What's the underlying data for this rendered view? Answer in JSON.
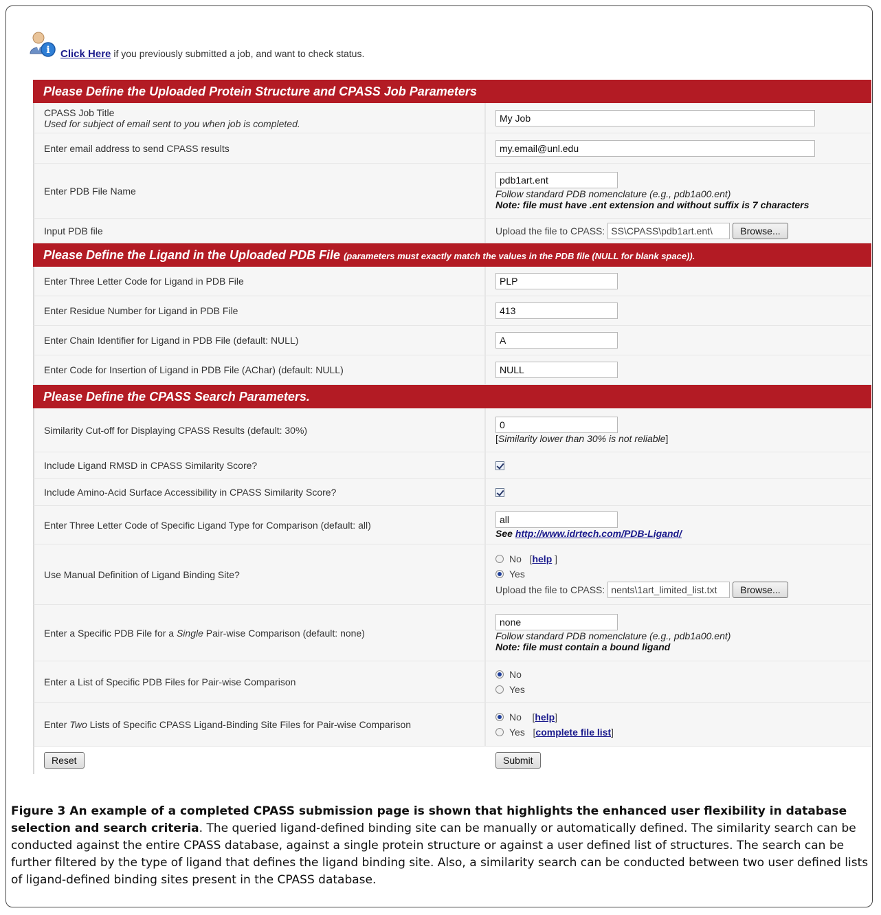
{
  "topbar": {
    "link": "Click Here",
    "text": "if you previously submitted a job, and want to check status."
  },
  "sections": {
    "s1": "Please Define the Uploaded Protein Structure and CPASS Job Parameters",
    "s2": "Please Define the Ligand in the Uploaded PDB File",
    "s2_sub": "(parameters must exactly match the values in the PDB file (NULL for blank space)).",
    "s3": "Please Define the CPASS Search Parameters."
  },
  "job": {
    "title_label": "CPASS Job Title",
    "title_note": "Used for subject of email sent to you when job is completed.",
    "title_value": "My Job",
    "email_label": "Enter email address to send CPASS results",
    "email_value": "my.email@unl.edu",
    "pdbname_label": "Enter PDB File Name",
    "pdbname_value": "pdb1art.ent",
    "pdbname_hint": "Follow standard PDB nomenclature (e.g., pdb1a00.ent)",
    "pdbname_note": "Note: file must have .ent extension and without suffix is 7 characters",
    "input_label": "Input PDB file",
    "upload_label": "Upload the file to CPASS:",
    "upload_value": "\\SS\\CPASS\\pdb1art.ent",
    "browse": "Browse..."
  },
  "ligand": {
    "code_label": "Enter Three Letter Code for Ligand in PDB File",
    "code_value": "PLP",
    "residue_label": "Enter Residue Number for Ligand in PDB File",
    "residue_value": "413",
    "chain_label": "Enter Chain Identifier for Ligand in PDB File (default: NULL)",
    "chain_value": "A",
    "insertion_label": "Enter Code for Insertion of Ligand in PDB File (AChar) (default: NULL)",
    "insertion_value": "NULL"
  },
  "search": {
    "cutoff_label": "Similarity Cut-off for Displaying CPASS Results (default: 30%)",
    "cutoff_value": "0",
    "cutoff_hint_open": "[",
    "cutoff_hint": "Similarity lower than 30% is not reliable",
    "cutoff_hint_close": "]",
    "rmsd_label": "Include Ligand RMSD in CPASS Similarity Score?",
    "rmsd_checked": true,
    "access_label": "Include Amino-Acid Surface Accessibility in CPASS Similarity Score?",
    "access_checked": true,
    "type_label": "Enter Three Letter Code of Specific Ligand Type for Comparison (default: all)",
    "type_value": "all",
    "type_see": "See",
    "type_link": "http://www.idrtech.com/PDB-Ligand/",
    "manual_label": "Use Manual Definition of Ligand Binding Site?",
    "no": "No",
    "yes": "Yes",
    "help": "help",
    "manual_upload_value": "nents\\1art_limited_list.txt",
    "single_label_a": "Enter a Specific PDB File for a",
    "single_label_em": "Single",
    "single_label_b": "Pair-wise Comparison (default: none)",
    "single_value": "none",
    "single_hint": "Follow standard PDB nomenclature (e.g., pdb1a00.ent)",
    "single_note": "Note: file must contain a bound ligand",
    "list_label": "Enter a List of Specific PDB Files for Pair-wise Comparison",
    "two_label_a": "Enter",
    "two_label_em": "Two",
    "two_label_b": "Lists of Specific CPASS Ligand-Binding Site Files for Pair-wise Comparison",
    "complete_list": "complete file list"
  },
  "buttons": {
    "reset": "Reset",
    "submit": "Submit"
  },
  "caption": {
    "bold": "Figure 3 An example of a completed CPASS submission page is shown that highlights the enhanced user flexibility in database selection and search criteria",
    "text": ". The queried ligand-defined binding site can be manually or automatically defined. The similarity search can be conducted against the entire CPASS database, against a single protein structure or against a user defined list of structures. The search can be further filtered by the type of ligand that defines the ligand binding site. Also, a similarity search can be conducted between two user defined lists of ligand-defined binding sites present in the CPASS database."
  }
}
